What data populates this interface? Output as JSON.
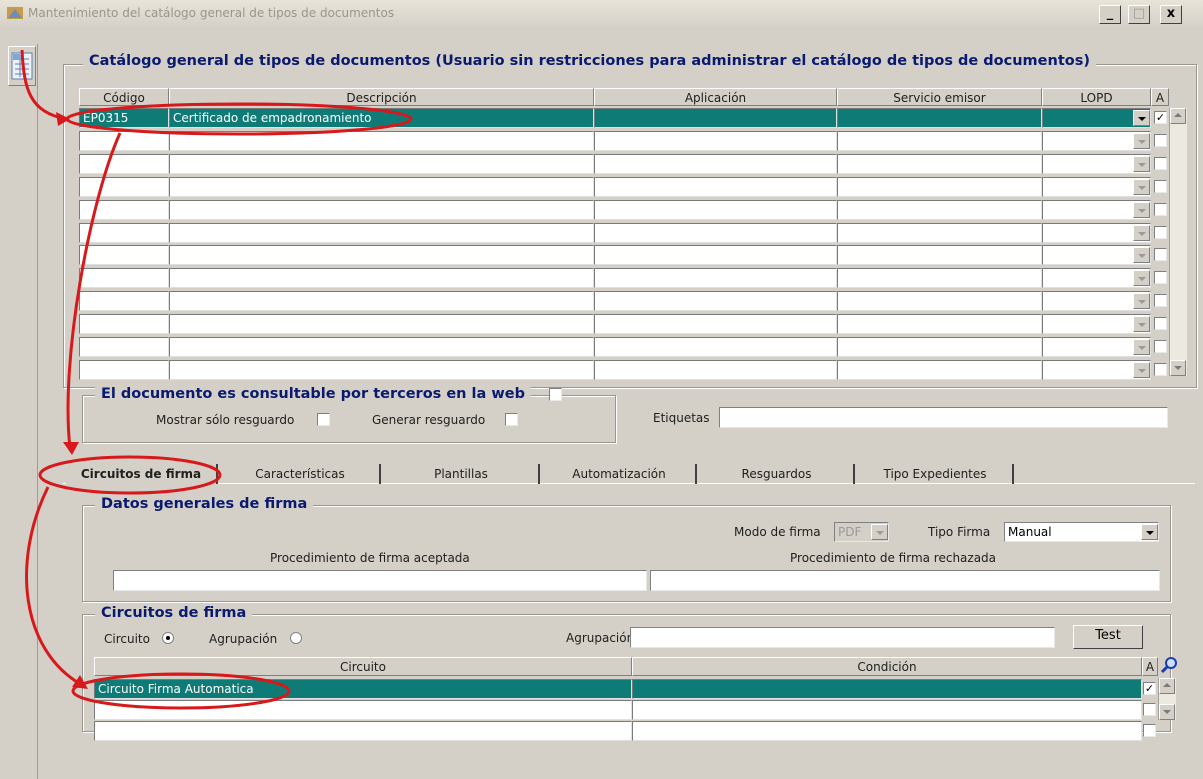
{
  "window": {
    "title": "Mantenimiento del catálogo general de tipos de documentos",
    "minimize": "_",
    "maximize": "□",
    "close": "x"
  },
  "catalog": {
    "legend": "Catálogo general de tipos de documentos  (Usuario sin restricciones para administrar el catálogo de tipos de documentos)",
    "columns": {
      "codigo": "Código",
      "descripcion": "Descripción",
      "aplicacion": "Aplicación",
      "servicio": "Servicio emisor",
      "lopd": "LOPD",
      "a": "A"
    },
    "rows": [
      {
        "codigo": "EP0315",
        "descripcion": "Certificado de empadronamiento",
        "aplicacion": "",
        "servicio": "",
        "lopd": "",
        "a": true
      },
      {
        "codigo": "",
        "descripcion": "",
        "aplicacion": "",
        "servicio": "",
        "lopd": "",
        "a": false
      },
      {
        "codigo": "",
        "descripcion": "",
        "aplicacion": "",
        "servicio": "",
        "lopd": "",
        "a": false
      },
      {
        "codigo": "",
        "descripcion": "",
        "aplicacion": "",
        "servicio": "",
        "lopd": "",
        "a": false
      },
      {
        "codigo": "",
        "descripcion": "",
        "aplicacion": "",
        "servicio": "",
        "lopd": "",
        "a": false
      },
      {
        "codigo": "",
        "descripcion": "",
        "aplicacion": "",
        "servicio": "",
        "lopd": "",
        "a": false
      },
      {
        "codigo": "",
        "descripcion": "",
        "aplicacion": "",
        "servicio": "",
        "lopd": "",
        "a": false
      },
      {
        "codigo": "",
        "descripcion": "",
        "aplicacion": "",
        "servicio": "",
        "lopd": "",
        "a": false
      },
      {
        "codigo": "",
        "descripcion": "",
        "aplicacion": "",
        "servicio": "",
        "lopd": "",
        "a": false
      },
      {
        "codigo": "",
        "descripcion": "",
        "aplicacion": "",
        "servicio": "",
        "lopd": "",
        "a": false
      },
      {
        "codigo": "",
        "descripcion": "",
        "aplicacion": "",
        "servicio": "",
        "lopd": "",
        "a": false
      },
      {
        "codigo": "",
        "descripcion": "",
        "aplicacion": "",
        "servicio": "",
        "lopd": "",
        "a": false
      }
    ]
  },
  "web": {
    "legend": "El documento es consultable por terceros en la web",
    "mostrar_label": "Mostrar sólo resguardo",
    "generar_label": "Generar resguardo",
    "etiquetas_label": "Etiquetas",
    "etiquetas_value": ""
  },
  "tabs": [
    "Circuitos de firma",
    "Características",
    "Plantillas",
    "Automatización",
    "Resguardos",
    "Tipo Expedientes"
  ],
  "firma": {
    "legend": "Datos generales de firma",
    "modo_label": "Modo de firma",
    "modo_value": "PDF",
    "tipo_label": "Tipo Firma",
    "tipo_value": "Manual",
    "aceptada_label": "Procedimiento de firma aceptada",
    "rechazada_label": "Procedimiento de firma rechazada",
    "aceptada_value": "",
    "rechazada_value": ""
  },
  "circuitos": {
    "legend": "Circuitos de firma",
    "circuito_label": "Circuito",
    "agrupacion_radio_label": "Agrupación",
    "agrupacion_label": "Agrupación",
    "agrupacion_value": "",
    "test_label": "Test",
    "columns": {
      "circuito": "Circuito",
      "condicion": "Condición",
      "a": "A"
    },
    "rows": [
      {
        "circuito": "Circuito Firma Automatica",
        "condicion": "",
        "a": true
      },
      {
        "circuito": "",
        "condicion": "",
        "a": false
      },
      {
        "circuito": "",
        "condicion": "",
        "a": false
      }
    ]
  },
  "colors": {
    "selection": "#0f7b77",
    "legend": "#0a1a6e",
    "annotation": "#d7191c",
    "background": "#d4d0c8"
  }
}
